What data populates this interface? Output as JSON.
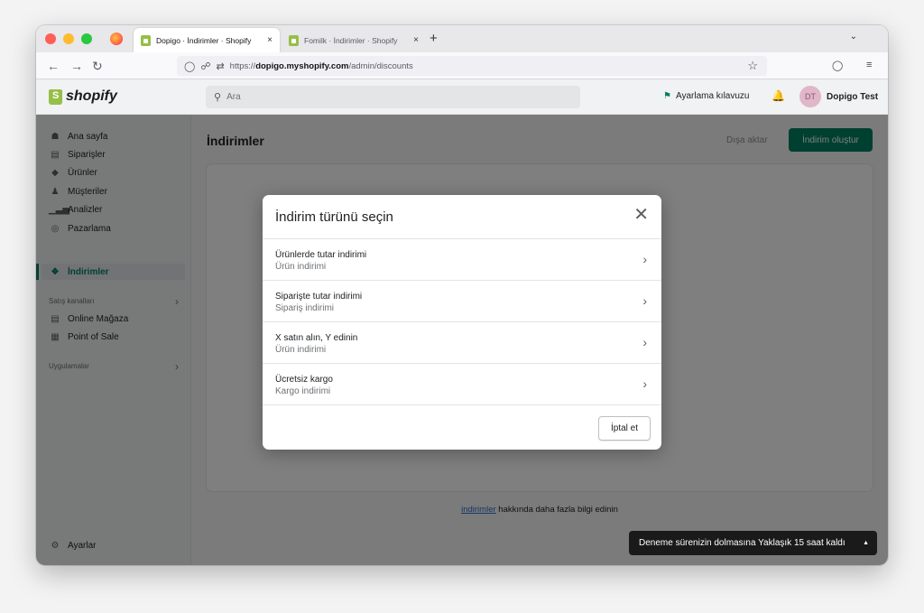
{
  "browser": {
    "tabs": [
      {
        "label": "Dopigo · İndirimler · Shopify",
        "close": "×"
      },
      {
        "label": "Fomilk · İndirimler · Shopify",
        "close": "×"
      }
    ],
    "new_tab": "+",
    "url_prefix": "https://",
    "url_domain": "dopigo.myshopify.com",
    "url_path": "/admin/discounts"
  },
  "header": {
    "logo_text": "shopify",
    "search_placeholder": "Ara",
    "setup_guide": "Ayarlama kılavuzu",
    "avatar_initials": "DT",
    "user_name": "Dopigo Test"
  },
  "sidebar": {
    "items": [
      {
        "label": "Ana sayfa",
        "icon": "home-icon"
      },
      {
        "label": "Siparişler",
        "icon": "orders-icon"
      },
      {
        "label": "Ürünler",
        "icon": "tag-icon"
      },
      {
        "label": "Müşteriler",
        "icon": "person-icon"
      },
      {
        "label": "Analizler",
        "icon": "analytics-icon"
      },
      {
        "label": "Pazarlama",
        "icon": "marketing-icon"
      },
      {
        "label": "İndirimler",
        "icon": "discount-icon"
      }
    ],
    "sales_channels_label": "Satış kanalları",
    "channels": [
      {
        "label": "Online Mağaza",
        "icon": "store-icon"
      },
      {
        "label": "Point of Sale",
        "icon": "pos-icon"
      }
    ],
    "apps_label": "Uygulamalar",
    "settings_label": "Ayarlar"
  },
  "main": {
    "title": "İndirimler",
    "export_label": "Dışa aktar",
    "create_label": "İndirim oluştur",
    "learn_link": "indirimler",
    "learn_text": " hakkında daha fazla bilgi edinin",
    "toast": "Deneme sürenizin dolmasına Yaklaşık 15 saat kaldı"
  },
  "modal": {
    "title": "İndirim türünü seçin",
    "options": [
      {
        "title": "Ürünlerde tutar indirimi",
        "subtitle": "Ürün indirimi"
      },
      {
        "title": "Siparişte tutar indirimi",
        "subtitle": "Sipariş indirimi"
      },
      {
        "title": "X satın alın, Y edinin",
        "subtitle": "Ürün indirimi"
      },
      {
        "title": "Ücretsiz kargo",
        "subtitle": "Kargo indirimi"
      }
    ],
    "cancel_label": "İptal et"
  },
  "colors": {
    "accent": "#008060",
    "brand": "#95bf47"
  }
}
